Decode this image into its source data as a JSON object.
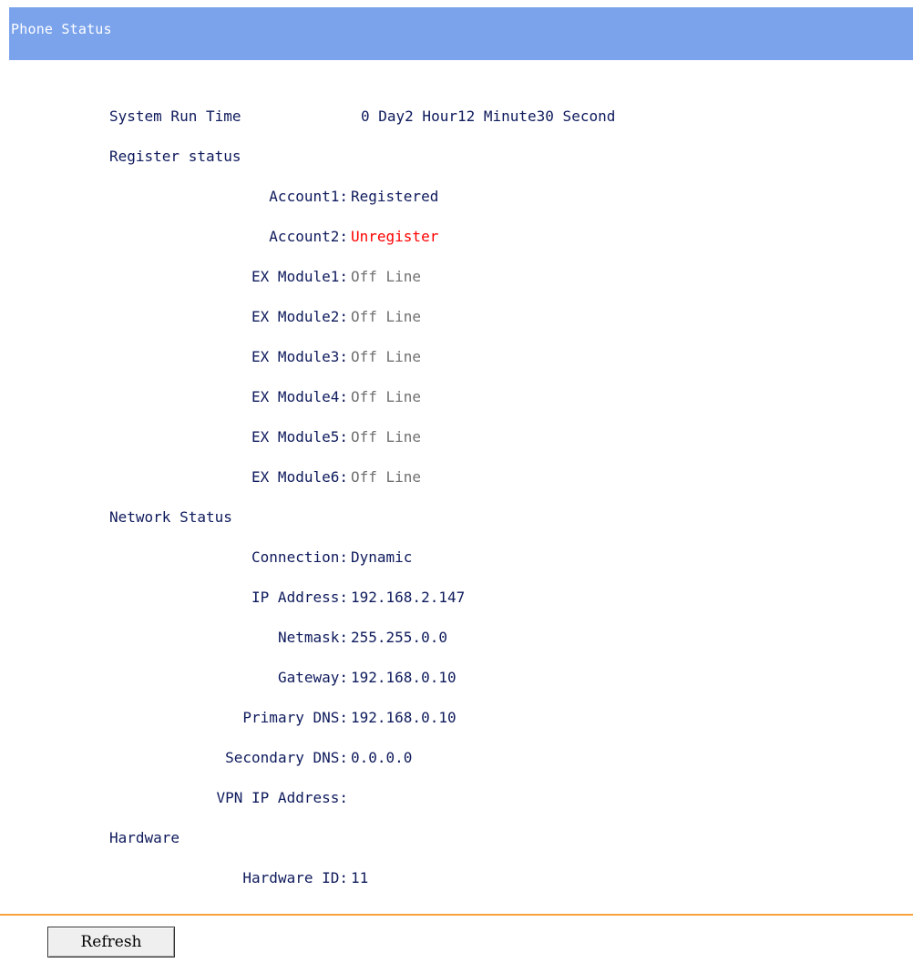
{
  "header": {
    "title": "Phone Status"
  },
  "system": {
    "run_time_label": "System Run Time",
    "run_time_value": "0 Day2 Hour12 Minute30 Second"
  },
  "register": {
    "section_label": "Register status",
    "items": [
      {
        "label": "Account1:",
        "value": "Registered",
        "status": "normal"
      },
      {
        "label": "Account2:",
        "value": "Unregister",
        "status": "error"
      },
      {
        "label": "EX Module1:",
        "value": "Off Line",
        "status": "offline"
      },
      {
        "label": "EX Module2:",
        "value": "Off Line",
        "status": "offline"
      },
      {
        "label": "EX Module3:",
        "value": "Off Line",
        "status": "offline"
      },
      {
        "label": "EX Module4:",
        "value": "Off Line",
        "status": "offline"
      },
      {
        "label": "EX Module5:",
        "value": "Off Line",
        "status": "offline"
      },
      {
        "label": "EX Module6:",
        "value": "Off Line",
        "status": "offline"
      }
    ]
  },
  "network": {
    "section_label": "Network Status",
    "items": [
      {
        "label": "Connection:",
        "value": "Dynamic"
      },
      {
        "label": "IP Address:",
        "value": "192.168.2.147"
      },
      {
        "label": "Netmask:",
        "value": "255.255.0.0"
      },
      {
        "label": "Gateway:",
        "value": "192.168.0.10"
      },
      {
        "label": "Primary DNS:",
        "value": "192.168.0.10"
      },
      {
        "label": "Secondary DNS:",
        "value": "0.0.0.0"
      },
      {
        "label": "VPN IP Address:",
        "value": ""
      }
    ]
  },
  "hardware": {
    "section_label": "Hardware",
    "items": [
      {
        "label": "Hardware ID:",
        "value": "11"
      }
    ]
  },
  "actions": {
    "refresh_label": "Refresh"
  },
  "colors": {
    "header_bg": "#7ba3ec",
    "text": "#0e1a5c",
    "error": "#ff0000",
    "offline": "#707070",
    "divider": "#f7a23b"
  }
}
